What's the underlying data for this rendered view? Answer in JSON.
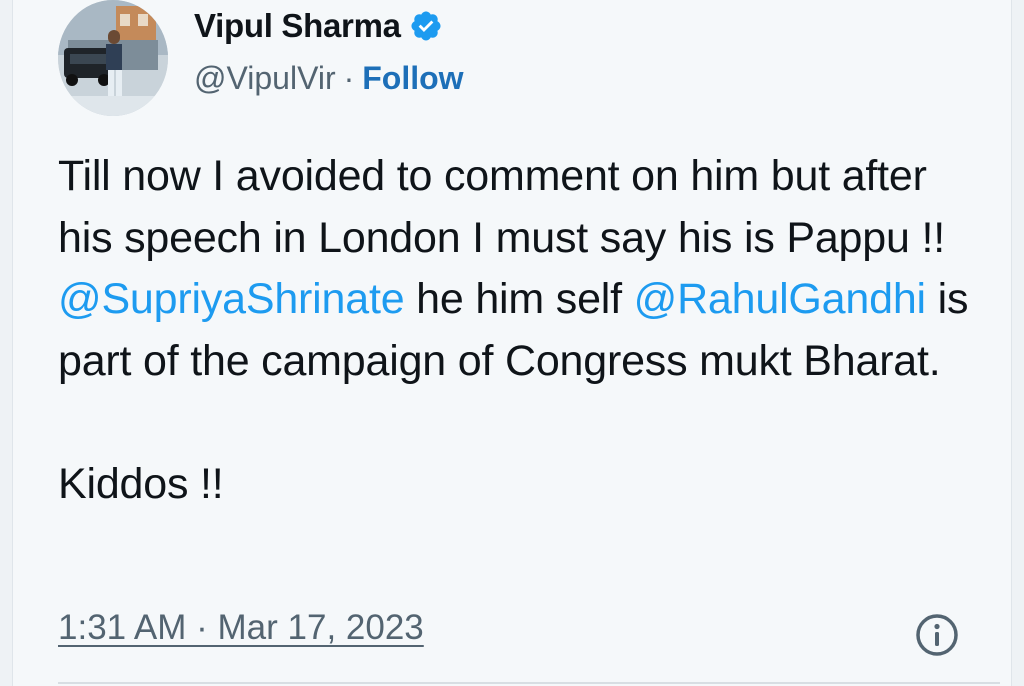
{
  "author": {
    "name": "Vipul Sharma",
    "handle": "@VipulVir",
    "separator": "·",
    "follow_label": "Follow",
    "verified": true,
    "verified_color": "#1d9bf0"
  },
  "tweet": {
    "segments_p1": [
      {
        "type": "text",
        "value": "Till now I avoided to comment on him but after his speech in London I must say his is Pappu !! "
      },
      {
        "type": "mention",
        "value": "@SupriyaShrinate"
      },
      {
        "type": "text",
        "value": " he him self "
      },
      {
        "type": "mention",
        "value": "@RahulGandhi"
      },
      {
        "type": "text",
        "value": " is part of the campaign of Congress mukt Bharat."
      }
    ],
    "paragraph_2": "Kiddos !!",
    "mention_color": "#1d9bf0"
  },
  "meta": {
    "timestamp": "1:31 AM · Mar 17, 2023",
    "info_icon": "info-icon"
  }
}
